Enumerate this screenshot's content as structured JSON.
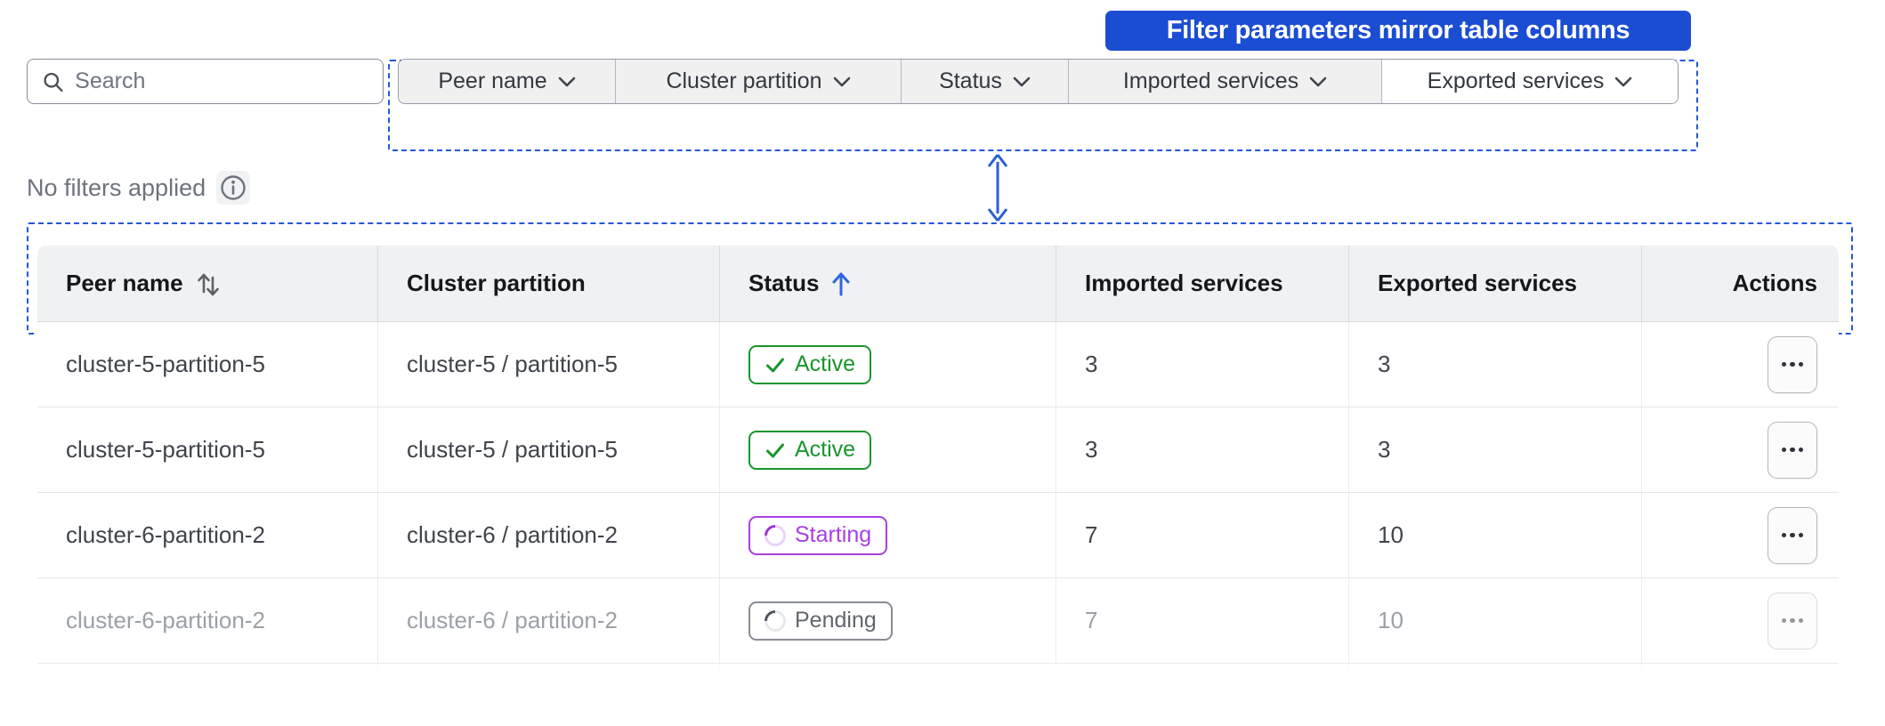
{
  "callout": {
    "label": "Filter parameters mirror table columns"
  },
  "search": {
    "placeholder": "Search"
  },
  "filters": {
    "items": [
      {
        "label": "Peer name"
      },
      {
        "label": "Cluster partition"
      },
      {
        "label": "Status"
      },
      {
        "label": "Imported services"
      },
      {
        "label": "Exported services"
      }
    ]
  },
  "filter_status": {
    "text": "No filters applied",
    "icon": "info-icon"
  },
  "table": {
    "columns": [
      {
        "label": "Peer name",
        "sort_icon": "sort-both"
      },
      {
        "label": "Cluster partition",
        "sort_icon": null
      },
      {
        "label": "Status",
        "sort_icon": "sort-up"
      },
      {
        "label": "Imported services",
        "sort_icon": null
      },
      {
        "label": "Exported services",
        "sort_icon": null
      },
      {
        "label": "Actions",
        "sort_icon": null
      }
    ],
    "sort": {
      "column": "Status",
      "direction": "ascending"
    },
    "rows": [
      {
        "peer_name": "cluster-5-partition-5",
        "cluster_partition": "cluster-5 / partition-5",
        "status": "Active",
        "imported": "3",
        "exported": "3",
        "faded": false
      },
      {
        "peer_name": "cluster-5-partition-5",
        "cluster_partition": "cluster-5 / partition-5",
        "status": "Active",
        "imported": "3",
        "exported": "3",
        "faded": false
      },
      {
        "peer_name": "cluster-6-partition-2",
        "cluster_partition": "cluster-6 / partition-2",
        "status": "Starting",
        "imported": "7",
        "exported": "10",
        "faded": false
      },
      {
        "peer_name": "cluster-6-partition-2",
        "cluster_partition": "cluster-6 / partition-2",
        "status": "Pending",
        "imported": "7",
        "exported": "10",
        "faded": true
      }
    ],
    "actions_icon": "ellipsis-icon"
  },
  "colors": {
    "callout_bg": "#1b4dd3",
    "annotation_dash": "#2457d8",
    "status_active": "#18962d",
    "status_starting": "#a93fe3",
    "status_pending": "#62676f",
    "table_header_bg": "#f0f1f3"
  }
}
